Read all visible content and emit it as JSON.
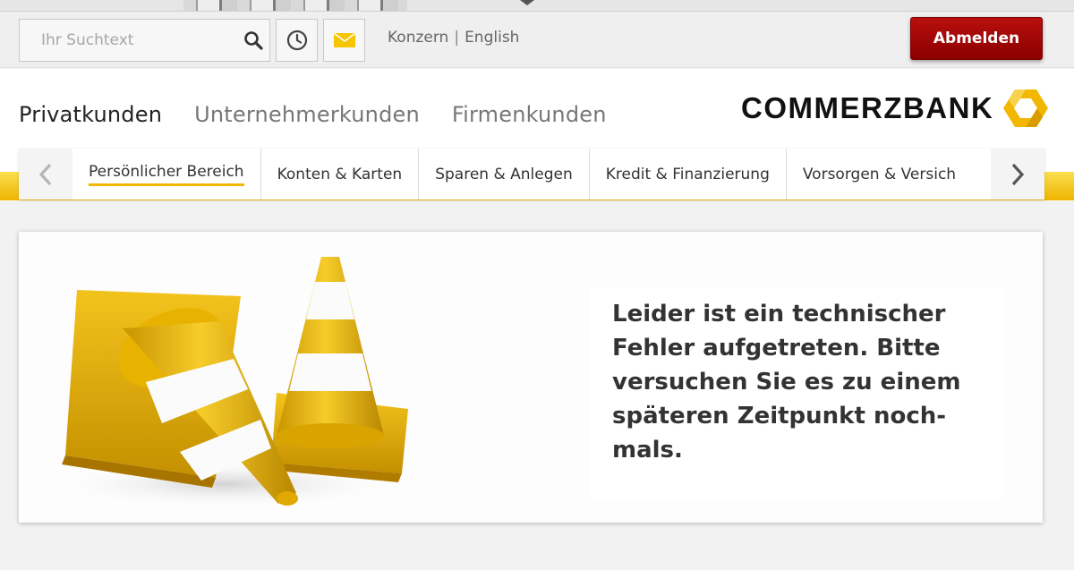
{
  "search": {
    "placeholder": "Ihr Suchtext"
  },
  "utility": {
    "links": [
      "Konzern",
      "English"
    ],
    "separator": "|",
    "logout_label": "Abmelden"
  },
  "segments": [
    {
      "label": "Privatkunden",
      "active": true
    },
    {
      "label": "Unternehmerkunden",
      "active": false
    },
    {
      "label": "Firmenkunden",
      "active": false
    }
  ],
  "logo": {
    "text": "COMMERZBANK"
  },
  "nav": {
    "items": [
      {
        "label": "Persönlicher Bereich",
        "active": true
      },
      {
        "label": "Konten & Karten"
      },
      {
        "label": "Sparen & Anlegen"
      },
      {
        "label": "Kredit & Finanzierung"
      },
      {
        "label": "Vorsorgen & Versich"
      }
    ]
  },
  "error": {
    "message": "Leider ist ein technischer Fehler aufgetreten. Bitte versuchen Sie es zu einem späteren Zeitpunkt noch-mals."
  },
  "colors": {
    "accent_yellow": "#f2b700",
    "logout_red": "#a00000",
    "text_dark": "#333333"
  }
}
